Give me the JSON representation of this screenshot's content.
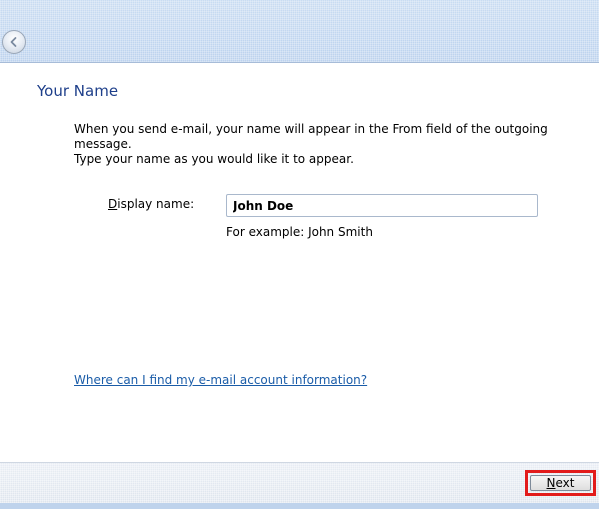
{
  "header": {
    "back_icon": "back-arrow-icon"
  },
  "page": {
    "title": "Your Name",
    "description_line1": "When you send e-mail, your name will appear in the From field of the outgoing message.",
    "description_line2": "Type your name as you would like it to appear."
  },
  "form": {
    "display_name_label_accel": "D",
    "display_name_label_rest": "isplay name:",
    "display_name_value": "John Doe",
    "example_text": "For example: John Smith"
  },
  "help": {
    "link_text": "Where can I find my e-mail account information?"
  },
  "footer": {
    "next_accel": "N",
    "next_rest": "ext",
    "highlight_color": "#e21b1b"
  }
}
